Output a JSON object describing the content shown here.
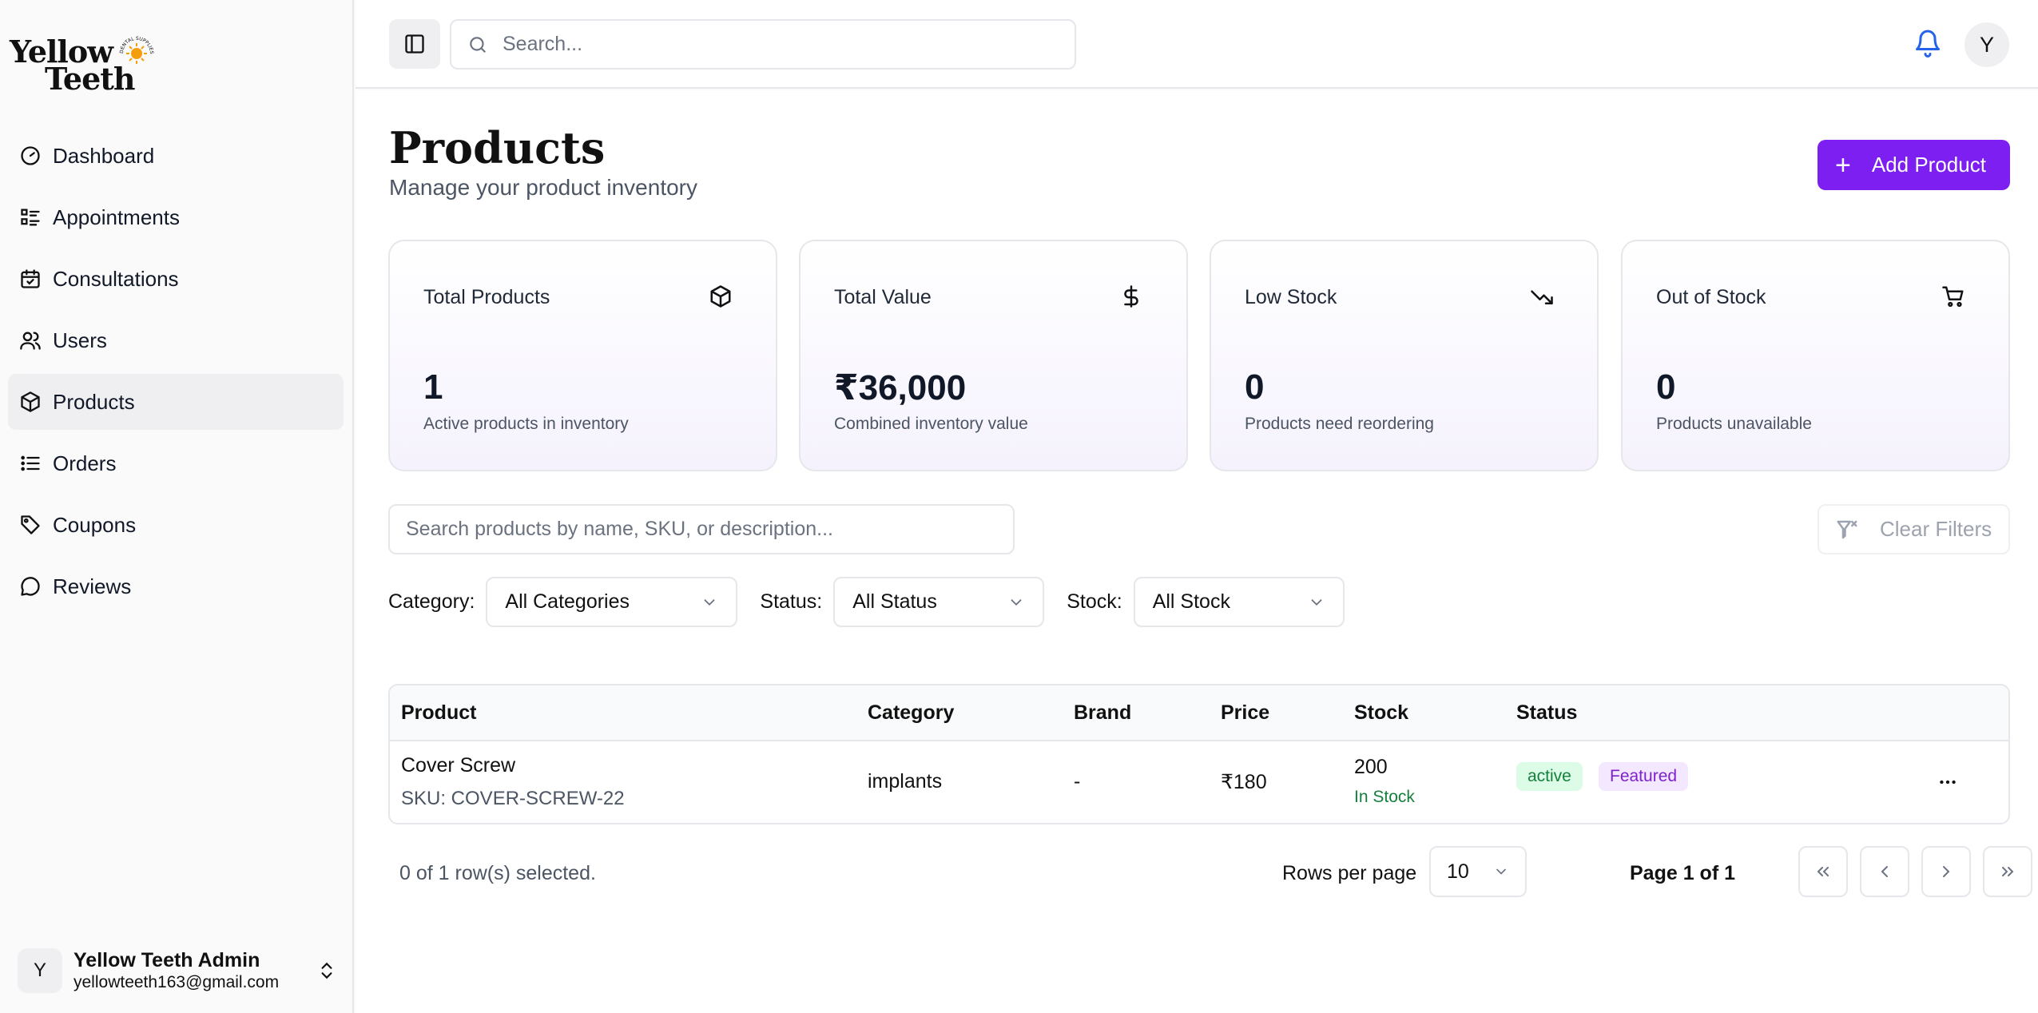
{
  "brand": {
    "line1": "Yellow",
    "line2": "Teeth",
    "tagline": "DENTAL SUPPLIES"
  },
  "sidebar": {
    "items": [
      {
        "label": "Dashboard",
        "icon": "gauge-icon"
      },
      {
        "label": "Appointments",
        "icon": "list-icon"
      },
      {
        "label": "Consultations",
        "icon": "calendar-icon"
      },
      {
        "label": "Users",
        "icon": "users-icon"
      },
      {
        "label": "Products",
        "icon": "package-icon",
        "active": true
      },
      {
        "label": "Orders",
        "icon": "list-ordered-icon"
      },
      {
        "label": "Coupons",
        "icon": "tag-icon"
      },
      {
        "label": "Reviews",
        "icon": "message-icon"
      }
    ],
    "user": {
      "initial": "Y",
      "name": "Yellow Teeth Admin",
      "email": "yellowteeth163@gmail.com"
    }
  },
  "topbar": {
    "search_placeholder": "Search...",
    "avatar_initial": "Y"
  },
  "page": {
    "title": "Products",
    "subtitle": "Manage your product inventory",
    "add_button": "Add Product"
  },
  "stats": [
    {
      "title": "Total Products",
      "value": "1",
      "desc": "Active products in inventory",
      "icon": "package-icon"
    },
    {
      "title": "Total Value",
      "value": "₹36,000",
      "desc": "Combined inventory value",
      "icon": "dollar-icon"
    },
    {
      "title": "Low Stock",
      "value": "0",
      "desc": "Products need reordering",
      "icon": "trending-down-icon"
    },
    {
      "title": "Out of Stock",
      "value": "0",
      "desc": "Products unavailable",
      "icon": "cart-icon"
    }
  ],
  "filters": {
    "search_placeholder": "Search products by name, SKU, or description...",
    "clear_label": "Clear Filters",
    "category_label": "Category:",
    "category_value": "All Categories",
    "status_label": "Status:",
    "status_value": "All Status",
    "stock_label": "Stock:",
    "stock_value": "All Stock"
  },
  "table": {
    "headers": [
      "Product",
      "Category",
      "Brand",
      "Price",
      "Stock",
      "Status"
    ],
    "rows": [
      {
        "product": "Cover Screw",
        "sku": "SKU: COVER-SCREW-22",
        "category": "implants",
        "brand": "-",
        "price": "₹180",
        "stock": "200",
        "stock_status": "In Stock",
        "status": "active",
        "featured": "Featured"
      }
    ]
  },
  "pagination": {
    "selection_text": "0 of 1 row(s) selected.",
    "rows_per_page_label": "Rows per page",
    "rows_per_page_value": "10",
    "page_info": "Page 1 of 1"
  },
  "colors": {
    "accent": "#7c1ff0",
    "success": "#15803d",
    "featured": "#7e22ce",
    "bell": "#2563eb"
  }
}
